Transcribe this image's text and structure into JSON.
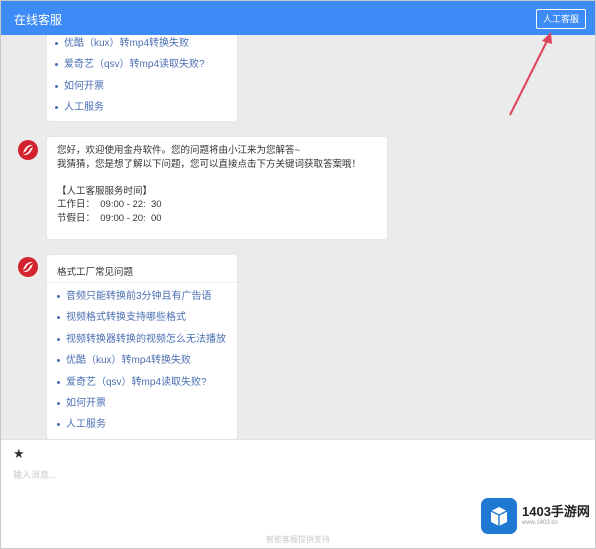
{
  "header": {
    "title": "在线客服",
    "agent_button": "人工客服"
  },
  "messages": {
    "top_links": [
      "优酷（kux）转mp4转换失败",
      "爱奇艺（qsv）转mp4读取失败?",
      "如何开票",
      "人工服务"
    ],
    "welcome": "您好，欢迎使用金舟软件。您的问题将由小江来为您解答~\n我猜猜，您是想了解以下问题，您可以直接点击下方关键词获取答案哦！\n\n【人工客服服务时间】\n工作日：  09:00 - 22:  30\n节假日：  09:00 - 20:  00",
    "faq_title": "格式工厂常见问题",
    "faq_links": [
      "音频只能转换前3分钟且有广告语",
      "视频格式转换支持哪些格式",
      "视频转换器转换的视频怎么无法播放",
      "优酷（kux）转mp4转换失败",
      "爱奇艺（qsv）转mp4读取失败?",
      "如何开票",
      "人工服务"
    ]
  },
  "composer": {
    "star_icon": "★",
    "placeholder": "输入消息...",
    "powered_by": "智能客服提供支持"
  },
  "watermark": {
    "name": "1403手游网",
    "url": "www.1403.cn"
  },
  "colors": {
    "header": "#3d8bf6",
    "link": "#4a6fb3",
    "arrow": "#e0455e",
    "avatar": "#d4232e"
  }
}
